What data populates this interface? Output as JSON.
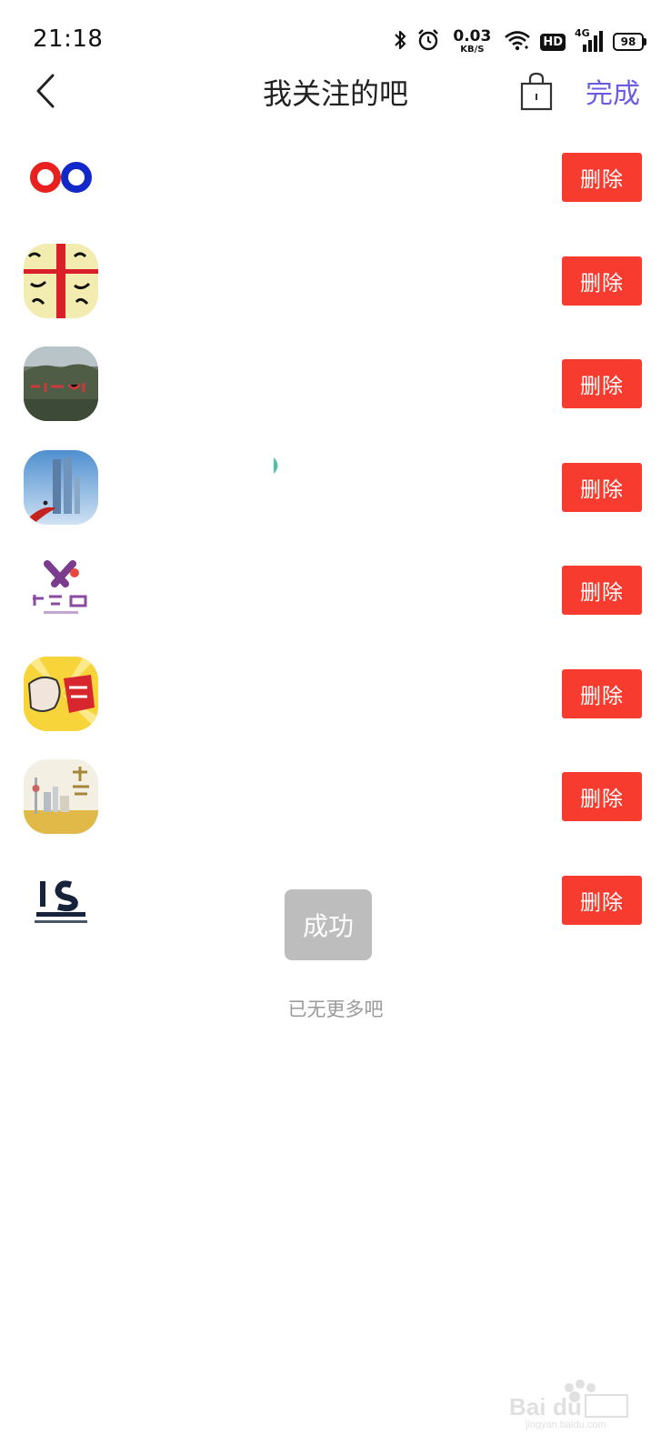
{
  "status_bar": {
    "time": "21:18",
    "net_speed_value": "0.03",
    "net_speed_unit": "KB/S",
    "hd_label": "HD",
    "network_label": "4G",
    "battery_level": "98",
    "icons": [
      "bluetooth-icon",
      "alarm-icon",
      "wifi-icon",
      "signal-icon",
      "battery-icon"
    ]
  },
  "header": {
    "title": "我关注的吧",
    "done_label": "完成",
    "back_icon": "chevron-left-icon",
    "bag_icon": "shopping-bag-icon",
    "accent_color": "#6a5be3"
  },
  "list": {
    "delete_color": "#f73b2f",
    "items": [
      {
        "avatar": "red-blue-rings-logo",
        "delete_label": "删除"
      },
      {
        "avatar": "calligraphy-banner-logo",
        "delete_label": "删除"
      },
      {
        "avatar": "landscape-sign-logo",
        "delete_label": "删除"
      },
      {
        "avatar": "twin-towers-logo",
        "delete_label": "删除"
      },
      {
        "avatar": "salesman-logo",
        "delete_label": "删除"
      },
      {
        "avatar": "comic-art-logo",
        "delete_label": "删除"
      },
      {
        "avatar": "shanghai-skyline-logo",
        "delete_label": "删除"
      },
      {
        "avatar": "photoshop-bar-logo",
        "delete_label": "删除"
      }
    ]
  },
  "toast": {
    "text": "成功"
  },
  "footer": {
    "end_text": "已无更多吧"
  }
}
